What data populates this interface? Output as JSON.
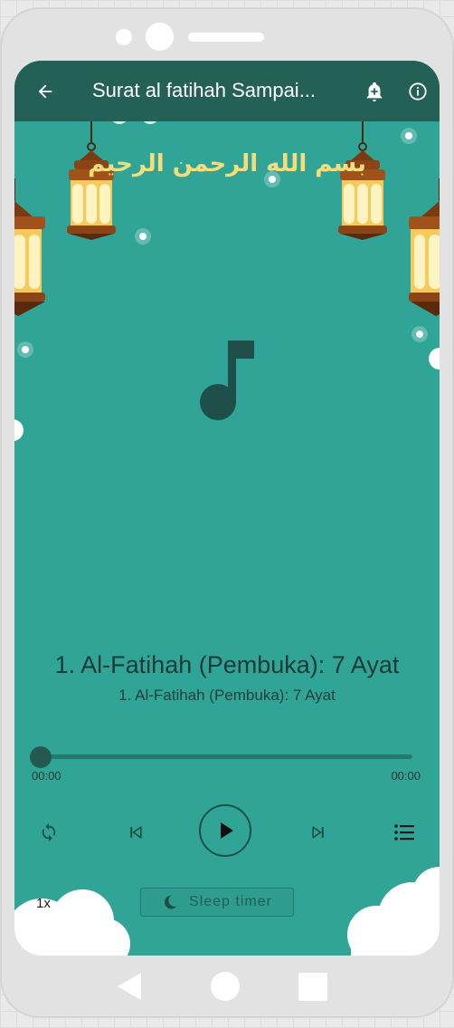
{
  "app_bar": {
    "title": "Surat al fatihah Sampai...",
    "back_icon": "arrow-left-icon",
    "notification_icon": "bell-plus-icon",
    "info_icon": "info-circle-icon"
  },
  "artwork": {
    "calligraphy_text": "بسم الله الرحمن الرحيم",
    "music_icon": "music-note-icon",
    "calligraphy_color": "#f4dd7a"
  },
  "player": {
    "track_title": "1. Al-Fatihah (Pembuka): 7 Ayat",
    "track_subtitle": "1. Al-Fatihah (Pembuka): 7 Ayat",
    "position": "00:00",
    "duration": "00:00",
    "progress": 0
  },
  "controls": {
    "repeat_icon": "repeat-icon",
    "previous_icon": "skip-previous-icon",
    "play_icon": "play-icon",
    "next_icon": "skip-next-icon",
    "queue_icon": "playlist-icon"
  },
  "extras": {
    "speed_label": "1x",
    "sleep_timer_label": "Sleep timer",
    "sleep_icon": "crescent-moon-icon"
  },
  "colors": {
    "app_bar": "#236156",
    "background": "#30a597",
    "accent_dark": "#23594f"
  }
}
